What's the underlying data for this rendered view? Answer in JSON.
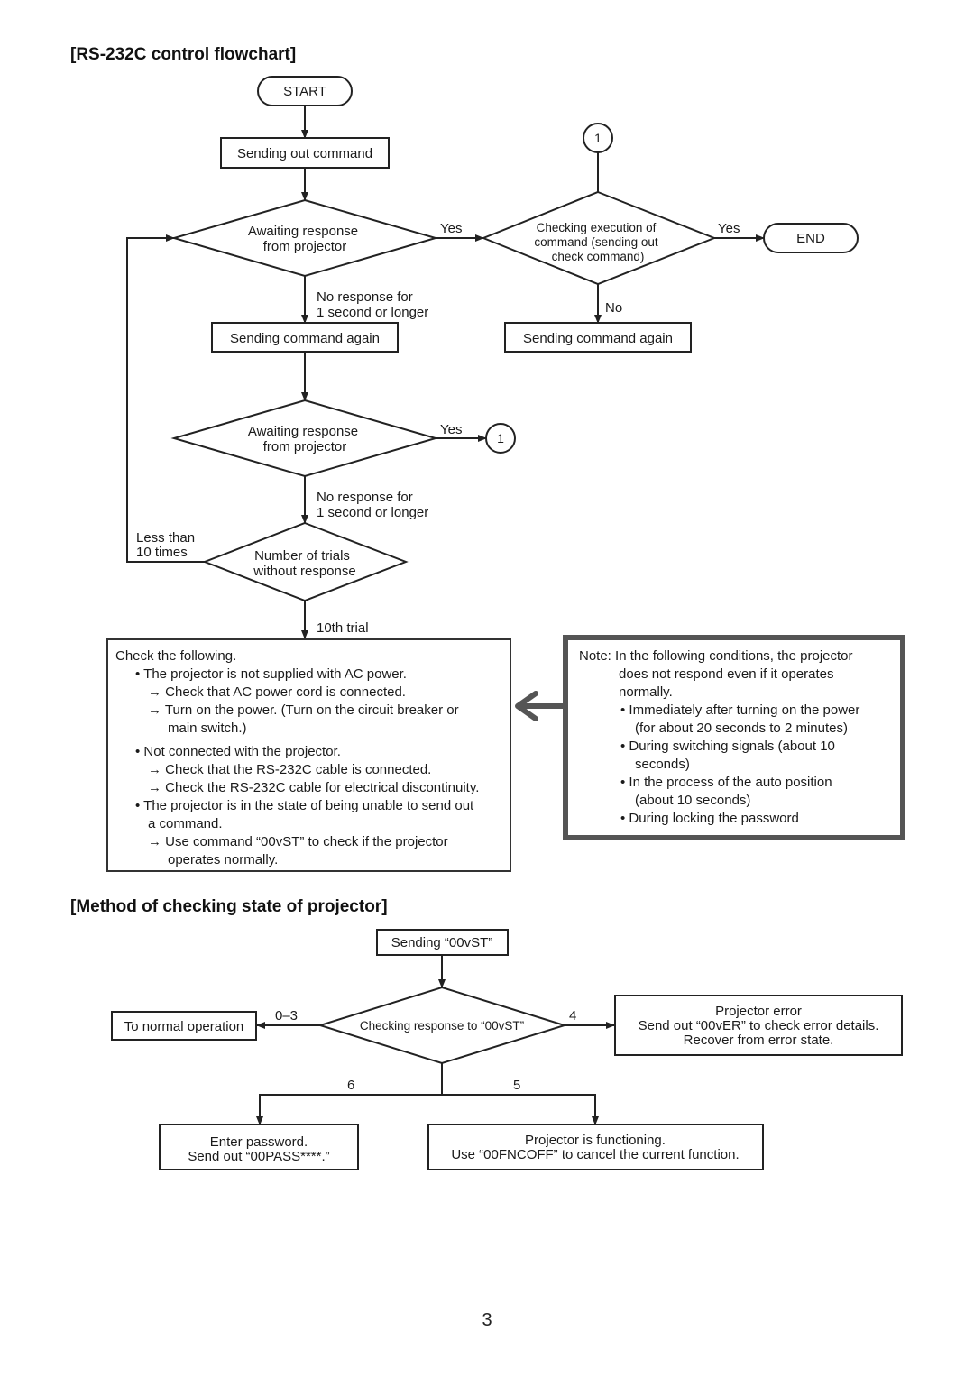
{
  "section1": {
    "title": "[RS-232C control  flowchart]",
    "start": "START",
    "send_command": "Sending out command",
    "await1": [
      "Awaiting response",
      "from projector"
    ],
    "yes": "Yes",
    "no": "No",
    "no_response": [
      "No response for",
      "1 second or longer"
    ],
    "send_again": "Sending command again",
    "await2": [
      "Awaiting response",
      "from projector"
    ],
    "connector": "1",
    "check_exec": [
      "Checking execution of",
      "command (sending out",
      "check command)"
    ],
    "end": "END",
    "send_again_right": "Sending command again",
    "trials": [
      "Number of trials",
      "without response"
    ],
    "less_than": [
      "Less than",
      "10 times"
    ],
    "tenth_trial": "10th trial",
    "check_box": {
      "heading": "Check the following.",
      "lines": [
        {
          "type": "bullet",
          "text": "The projector is not supplied with AC power."
        },
        {
          "type": "arrow",
          "text": "Check that AC power cord is connected."
        },
        {
          "type": "arrow",
          "text": "Turn on the power. (Turn on the circuit breaker or"
        },
        {
          "type": "cont2",
          "text": "main switch.)"
        },
        {
          "type": "bullet",
          "text": "Not connected with the projector."
        },
        {
          "type": "arrow",
          "text": "Check that the RS-232C cable is connected."
        },
        {
          "type": "arrow",
          "text": "Check the RS-232C cable for electrical discontinuity."
        },
        {
          "type": "bullet",
          "text": "The projector is in the state of being unable to send out"
        },
        {
          "type": "cont1",
          "text": "a command."
        },
        {
          "type": "arrow",
          "text": "Use command “00vST” to check if the projector"
        },
        {
          "type": "cont2",
          "text": "operates normally."
        }
      ]
    },
    "note_box": {
      "label": "Note:",
      "lines": [
        {
          "type": "first",
          "text": "In the following conditions, the projector"
        },
        {
          "type": "indent",
          "text": "does not respond even if it operates"
        },
        {
          "type": "indent",
          "text": "normally."
        },
        {
          "type": "bullet",
          "text": "Immediately after turning on the power"
        },
        {
          "type": "cont",
          "text": "(for about 20 seconds to 2 minutes)"
        },
        {
          "type": "bullet",
          "text": "During switching signals (about 10"
        },
        {
          "type": "cont",
          "text": "seconds)"
        },
        {
          "type": "bullet",
          "text": "In the process of the auto position"
        },
        {
          "type": "cont",
          "text": "(about 10 seconds)"
        },
        {
          "type": "bullet",
          "text": "During locking the password"
        }
      ]
    }
  },
  "section2": {
    "title": "[Method of checking state of projector]",
    "sending": "Sending “00vST”",
    "checking": "Checking response to “00vST”",
    "label_0_3": "0–3",
    "label_4": "4",
    "label_5": "5",
    "label_6": "6",
    "normal": "To normal operation",
    "error": [
      "Projector error",
      "Send out “00vER” to check error details.",
      "Recover from error state."
    ],
    "password": [
      "Enter password.",
      "Send out “00PASS****.”"
    ],
    "functioning": [
      "Projector is functioning.",
      "Use “00FNCOFF” to cancel the current function."
    ]
  },
  "page_number": "3"
}
